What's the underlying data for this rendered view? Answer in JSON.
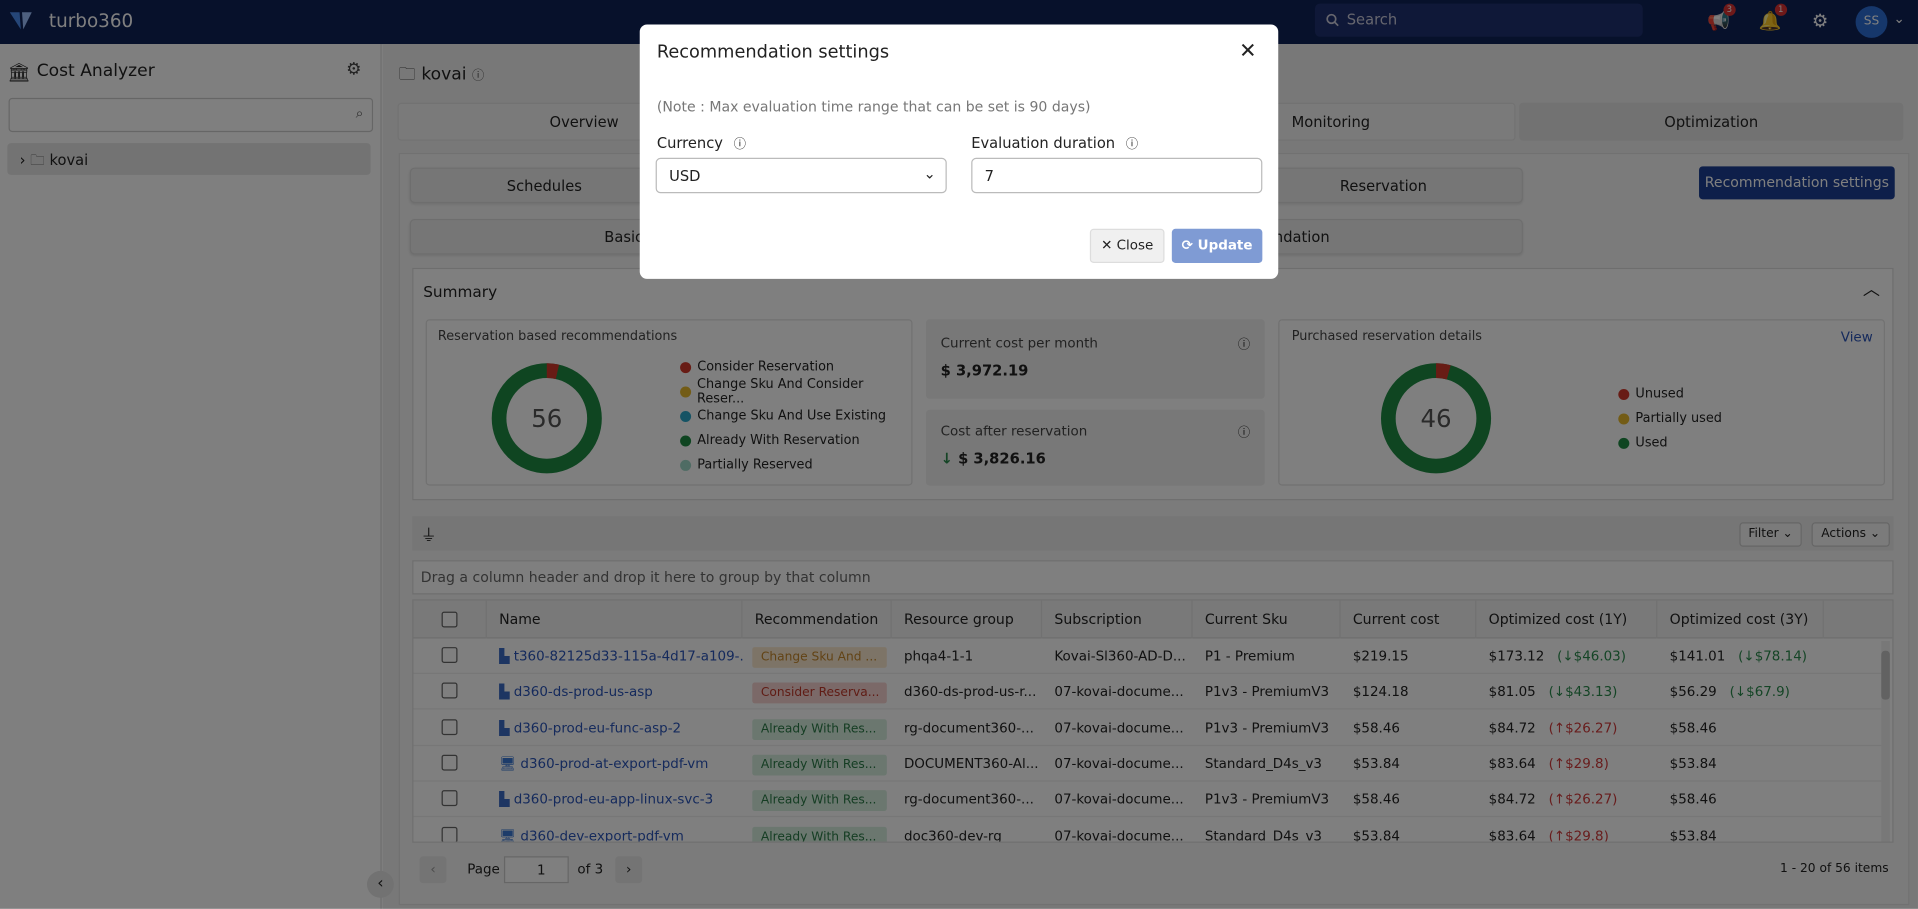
{
  "topbar": {
    "brand": "turbo360",
    "search_placeholder": "Search",
    "announcements_badge": "3",
    "notifications_badge": "1",
    "avatar": "SS"
  },
  "sidebar": {
    "title": "Cost Analyzer",
    "tree": [
      {
        "label": "kovai"
      }
    ]
  },
  "header": {
    "title": "kovai"
  },
  "tabs": [
    {
      "label": "Overview"
    },
    {
      "label": ""
    },
    {
      "label": "Monitoring"
    },
    {
      "label": "Optimization",
      "active": true
    }
  ],
  "subtabs": {
    "row1": [
      "Schedules",
      "",
      "Reservation"
    ],
    "row2_left": "Basic",
    "row2_right": "ndation"
  },
  "recommendation_settings_button": "Recommendation settings",
  "summary": {
    "title": "Summary",
    "left": {
      "title": "Reservation based recommendations",
      "total": "56",
      "legend": [
        {
          "label": "Consider Reservation",
          "color": "#d0392b"
        },
        {
          "label": "Change Sku And Consider Reser...",
          "color": "#e6b92d"
        },
        {
          "label": "Change Sku And Use Existing",
          "color": "#2aa6c9"
        },
        {
          "label": "Already With Reservation",
          "color": "#1e8a43"
        },
        {
          "label": "Partially Reserved",
          "color": "#9fd8c8"
        }
      ],
      "share_consider": 0.036
    },
    "current_cost_label": "Current cost per month",
    "current_cost": "$ 3,972.19",
    "after_label": "Cost after reservation",
    "after_cost": "$ 3,826.16",
    "right": {
      "title": "Purchased reservation details",
      "view": "View",
      "total": "46",
      "legend": [
        {
          "label": "Unused",
          "color": "#d0392b"
        },
        {
          "label": "Partially used",
          "color": "#e6b92d"
        },
        {
          "label": "Used",
          "color": "#1e8a43"
        }
      ],
      "share_unused": 0.043
    }
  },
  "toolbar": {
    "filter": "Filter",
    "actions": "Actions"
  },
  "group_hint": "Drag a column header and drop it here to group by that column",
  "columns": [
    "Name",
    "Recommendation",
    "Resource group",
    "Subscription",
    "Current Sku",
    "Current cost",
    "Optimized cost (1Y)",
    "Optimized cost (3Y)"
  ],
  "rows": [
    {
      "name": "t360-82125d33-115a-4d17-a109-...",
      "icon": "app-service",
      "rec": "Change Sku And ...",
      "rec_type": "change",
      "rg": "phqa4-1-1",
      "sub": "Kovai-Sl360-AD-D...",
      "sku": "P1 - Premium",
      "cost": "$219.15",
      "o1": "$173.12",
      "d1": "(↓$46.03)",
      "d1t": "dn",
      "o3": "$141.01",
      "d3": "(↓$78.14)",
      "d3t": "dn"
    },
    {
      "name": "d360-ds-prod-us-asp",
      "icon": "app-service",
      "rec": "Consider Reserva...",
      "rec_type": "consider",
      "rg": "d360-ds-prod-us-r...",
      "sub": "07-kovai-docume...",
      "sku": "P1v3 - PremiumV3",
      "cost": "$124.18",
      "o1": "$81.05",
      "d1": "(↓$43.13)",
      "d1t": "dn",
      "o3": "$56.29",
      "d3": "(↓$67.9)",
      "d3t": "dn"
    },
    {
      "name": "d360-prod-eu-func-asp-2",
      "icon": "app-service",
      "rec": "Already With Res...",
      "rec_type": "already",
      "rg": "rg-document360-...",
      "sub": "07-kovai-docume...",
      "sku": "P1v3 - PremiumV3",
      "cost": "$58.46",
      "o1": "$84.72",
      "d1": "(↑$26.27)",
      "d1t": "up",
      "o3": "$58.46",
      "d3": "",
      "d3t": ""
    },
    {
      "name": "d360-prod-at-export-pdf-vm",
      "icon": "vm",
      "rec": "Already With Res...",
      "rec_type": "already",
      "rg": "DOCUMENT360-Al...",
      "sub": "07-kovai-docume...",
      "sku": "Standard_D4s_v3",
      "cost": "$53.84",
      "o1": "$83.64",
      "d1": "(↑$29.8)",
      "d1t": "up",
      "o3": "$53.84",
      "d3": "",
      "d3t": ""
    },
    {
      "name": "d360-prod-eu-app-linux-svc-3",
      "icon": "app-service",
      "rec": "Already With Res...",
      "rec_type": "already",
      "rg": "rg-document360-...",
      "sub": "07-kovai-docume...",
      "sku": "P1v3 - PremiumV3",
      "cost": "$58.46",
      "o1": "$84.72",
      "d1": "(↑$26.27)",
      "d1t": "up",
      "o3": "$58.46",
      "d3": "",
      "d3t": ""
    },
    {
      "name": "d360-dev-export-pdf-vm",
      "icon": "vm",
      "rec": "Already With Res...",
      "rec_type": "already",
      "rg": "doc360-dev-rg",
      "sub": "07-kovai-docume...",
      "sku": "Standard_D4s_v3",
      "cost": "$53.84",
      "o1": "$83.64",
      "d1": "(↑$29.8)",
      "d1t": "up",
      "o3": "$53.84",
      "d3": "",
      "d3t": ""
    }
  ],
  "pager": {
    "label": "Page",
    "page": "1",
    "of": "of 3",
    "summary": "1 - 20 of 56 items"
  },
  "modal": {
    "title": "Recommendation settings",
    "note": "(Note : Max evaluation time range that can be set is 90 days)",
    "currency_label": "Currency",
    "currency": "USD",
    "duration_label": "Evaluation duration",
    "duration": "7",
    "close": "Close",
    "update": "Update"
  }
}
